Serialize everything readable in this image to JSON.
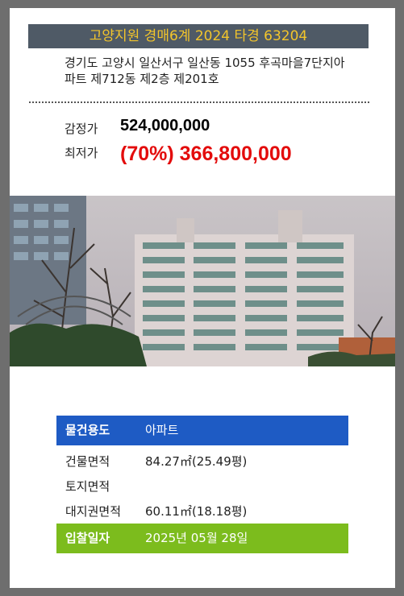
{
  "header": {
    "title": "고양지원 경매6계 2024 타경 63204"
  },
  "property": {
    "address_line1": "경기도 고양시 일산서구 일산동 1055 후곡마을7단지아",
    "address_line2": "파트 제712동 제2층 제201호"
  },
  "prices": {
    "appraisal_label": "감정가",
    "appraisal_value": "524,000,000",
    "minimum_label": "최저가",
    "minimum_value": "(70%) 366,800,000"
  },
  "details": {
    "usage_label": "물건용도",
    "usage_value": "아파트",
    "building_area_label": "건물면적",
    "building_area_value": "84.27㎡(25.49평)",
    "land_area_label": "토지면적",
    "land_area_value": "",
    "land_right_label": "대지권면적",
    "land_right_value": "60.11㎡(18.18평)",
    "bid_date_label": "입찰일자",
    "bid_date_value": "2025년 05월 28일"
  },
  "colors": {
    "header_bg": "#4f5a66",
    "header_text": "#f3c52b",
    "min_price": "#e30c0c",
    "usage_bar": "#1e5bc4",
    "date_bar": "#7cbc1d"
  }
}
